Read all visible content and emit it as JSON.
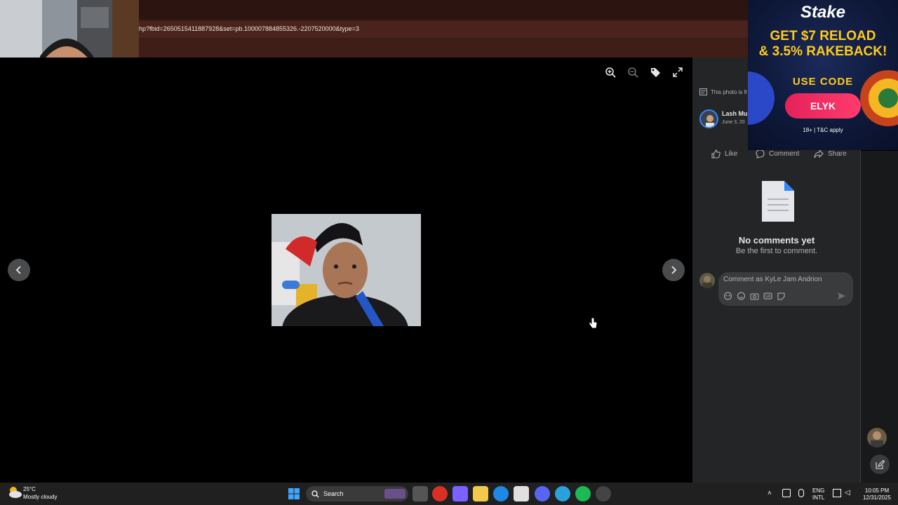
{
  "browser": {
    "url": "hp?fbid=2650515411887928&set=pb.100007884855326.-2207520000&type=3"
  },
  "viewer": {
    "toolbar": {
      "zoom_in_icon": "zoom-in-icon",
      "zoom_out_icon": "zoom-out-icon",
      "tag_icon": "tag-icon",
      "fullscreen_icon": "fullscreen-icon"
    },
    "prev_label": "‹",
    "next_label": "›"
  },
  "sidepanel": {
    "notice": "This photo is fr",
    "author_name": "Lash Mu",
    "post_date": "June 3, 20",
    "actions": [
      {
        "icon": "like-icon",
        "label": "Like"
      },
      {
        "icon": "comment-icon",
        "label": "Comment"
      },
      {
        "icon": "share-icon",
        "label": "Share"
      }
    ],
    "empty_title": "No comments yet",
    "empty_subtitle": "Be the first to comment.",
    "comment_placeholder": "Comment as KyLe Jam Andrion"
  },
  "ad": {
    "brand": "Stake",
    "headline_line1": "GET $7 RELOAD",
    "headline_line2": "& 3.5% RAKEBACK!",
    "use_code": "USE CODE",
    "code": "ELYK",
    "disclaimer": "18+ | T&C apply"
  },
  "taskbar": {
    "weather_temp": "25°C",
    "weather_desc": "Mostly cloudy",
    "search_label": "Search",
    "lang_line1": "ENG",
    "lang_line2": "INTL",
    "time": "10:05 PM",
    "date": "12/31/2025"
  },
  "colors": {
    "panel_bg": "#242526",
    "ad_code_button": "#e4225a",
    "ad_headline": "#ffcc1a",
    "taskbar_bg": "#202020"
  }
}
